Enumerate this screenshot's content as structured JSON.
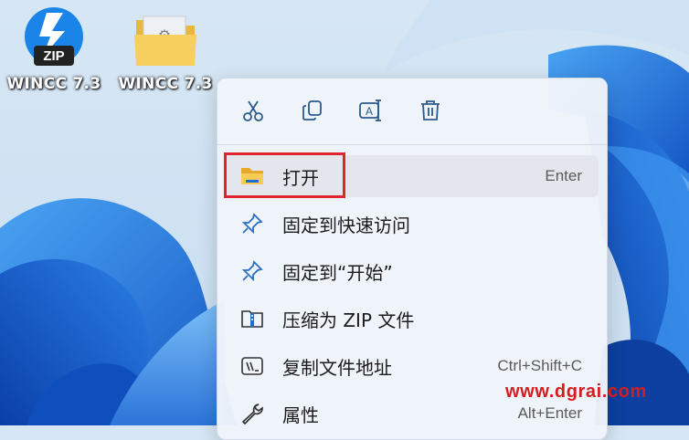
{
  "desktop": {
    "icons": [
      {
        "label": "WINCC 7.3",
        "icon": "zip-archive-icon"
      },
      {
        "label": "WINCC 7.3",
        "icon": "folder-icon"
      }
    ]
  },
  "context_menu": {
    "toolbar": [
      {
        "icon": "cut-icon"
      },
      {
        "icon": "copy-icon"
      },
      {
        "icon": "rename-icon"
      },
      {
        "icon": "delete-icon"
      }
    ],
    "items": [
      {
        "label": "打开",
        "shortcut": "Enter",
        "icon": "folder-open-icon"
      },
      {
        "label": "固定到快速访问",
        "shortcut": "",
        "icon": "pin-icon"
      },
      {
        "label": "固定到“开始”",
        "shortcut": "",
        "icon": "pin-icon"
      },
      {
        "label": "压缩为 ZIP 文件",
        "shortcut": "",
        "icon": "zip-compress-icon"
      },
      {
        "label": "复制文件地址",
        "shortcut": "Ctrl+Shift+C",
        "icon": "copy-path-icon"
      },
      {
        "label": "属性",
        "shortcut": "Alt+Enter",
        "icon": "wrench-icon"
      }
    ]
  },
  "watermark": "www.dgrai.com",
  "colors": {
    "highlight": "#e0242f",
    "wallpaper_blue": "#1f6ed4",
    "menu_bg": "#f0f4fa"
  }
}
